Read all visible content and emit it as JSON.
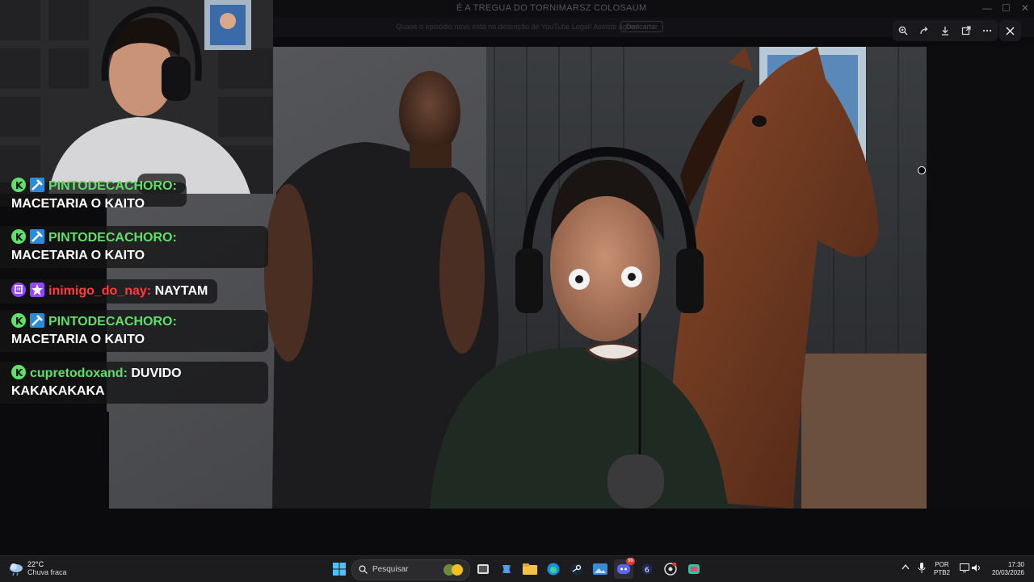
{
  "window": {
    "background_title": "É A TREGUA DO TORNIMARSZ COLOSAUM",
    "banner_text": "Quase o episódio novo está na descrição de YouTube Legal! Assiste agora!",
    "banner_button": "Descartar",
    "minimize": "—",
    "maximize": "☐",
    "close": "✕"
  },
  "viewer_toolbar": {
    "zoom_icon": "zoom-in-icon",
    "share_icon": "share-icon",
    "download_icon": "download-icon",
    "open_icon": "open-external-icon",
    "more_icon": "more-icon",
    "close_icon": "close-icon"
  },
  "chat": {
    "messages": [
      {
        "user": "PINTODECACHORO:",
        "text": "MACETARIA O KAITO",
        "user_color": "#5fe06a",
        "badges": [
          "kick-badge",
          "pickaxe-badge"
        ]
      },
      {
        "user": "PINTODECACHORO:",
        "text": "MACETARIA O KAITO",
        "user_color": "#5fe06a",
        "badges": [
          "kick-badge",
          "pickaxe-badge"
        ]
      },
      {
        "user": "inimigo_do_nay:",
        "text": "NAYTAM",
        "user_color": "#ff3b3b",
        "badges": [
          "twitch-badge",
          "star-badge"
        ]
      },
      {
        "user": "PINTODECACHORO:",
        "text": "MACETARIA O KAITO",
        "user_color": "#5fe06a",
        "badges": [
          "kick-badge",
          "pickaxe-badge"
        ]
      },
      {
        "user": "cupretodoxand:",
        "text": "DUVIDO KAKAKAKAKA",
        "user_color": "#5fe06a",
        "badges": [
          "kick-badge"
        ]
      }
    ]
  },
  "taskbar": {
    "weather_temp": "22°C",
    "weather_desc": "Chuva fraca",
    "search_placeholder": "Pesquisar",
    "language": "POR",
    "layout": "PTB2",
    "time": "17:30",
    "date": "20/03/2026",
    "discord_badge": "99"
  },
  "colors": {
    "accent_green": "#5fe06a",
    "accent_red": "#ff3b3b",
    "twitch_purple": "#9146ff"
  }
}
